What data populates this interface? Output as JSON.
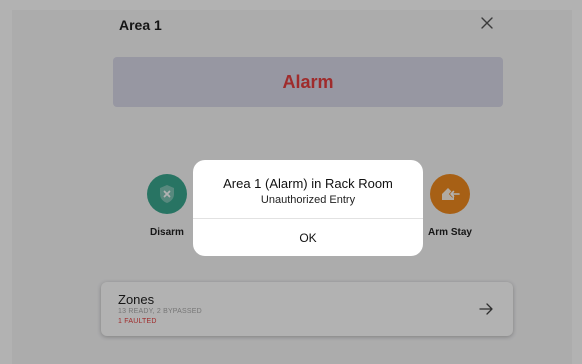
{
  "header": {
    "title": "Area 1",
    "close_icon": "close-icon"
  },
  "status": {
    "label": "Alarm",
    "color": "#e43f3f"
  },
  "actions": {
    "disarm": {
      "label": "Disarm",
      "icon": "shield-x-icon",
      "color": "#3aa78e"
    },
    "arm_stay": {
      "label": "Arm Stay",
      "icon": "house-arrow-icon",
      "color": "#ef8a1f"
    }
  },
  "zones": {
    "title": "Zones",
    "summary": "13 READY, 2 BYPASSED",
    "faulted": "1 FAULTED",
    "arrow_icon": "arrow-right-icon"
  },
  "dialog": {
    "title": "Area 1 (Alarm) in Rack Room",
    "message": "Unauthorized Entry",
    "ok_label": "OK"
  }
}
